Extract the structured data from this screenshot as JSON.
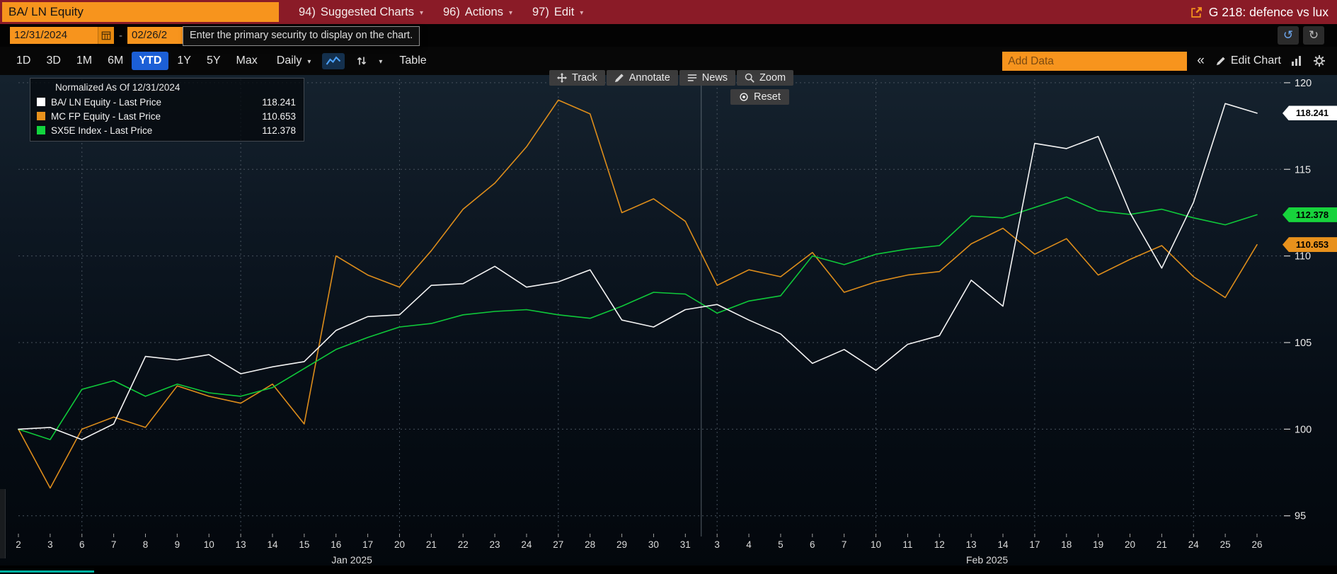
{
  "icons": {
    "caret": "▾",
    "collapse": "«",
    "undo": "↺",
    "redo": "↻",
    "dash": "-"
  },
  "title_bar": {
    "security_input": "BA/ LN Equity",
    "menus": [
      {
        "num": "94)",
        "label": "Suggested Charts"
      },
      {
        "num": "96)",
        "label": "Actions"
      },
      {
        "num": "97)",
        "label": "Edit"
      }
    ],
    "window_title": "G 218: defence vs lux"
  },
  "date_row": {
    "date_from": "12/31/2024",
    "date_to": "02/26/2",
    "tooltip": "Enter the primary security to display on the chart."
  },
  "toolbar_row2": {
    "periods": [
      "1D",
      "3D",
      "1M",
      "6M",
      "YTD",
      "1Y",
      "5Y",
      "Max"
    ],
    "active_period": "YTD",
    "frequency": "Daily",
    "table_label": "Table",
    "add_data_placeholder": "Add Data",
    "edit_chart_label": "Edit Chart",
    "active_period_color": "#1c5fd6",
    "accent_orange": "#f7941d"
  },
  "chart_overlay": {
    "legend_title": "Normalized As Of 12/31/2024",
    "legend_items": [
      {
        "label": "BA/ LN Equity - Last Price",
        "value": "118.241",
        "color": "#ffffff"
      },
      {
        "label": "MC FP Equity - Last Price",
        "value": "110.653",
        "color": "#e8911c"
      },
      {
        "label": "SX5E Index - Last Price",
        "value": "112.378",
        "color": "#12d43e"
      }
    ],
    "tools": [
      "Track",
      "Annotate",
      "News",
      "Zoom"
    ],
    "reset_label": "Reset",
    "badges": [
      {
        "value": "118.241",
        "bg": "#ffffff"
      },
      {
        "value": "112.378",
        "bg": "#17d33c"
      },
      {
        "value": "110.653",
        "bg": "#e8911c"
      }
    ]
  },
  "chart_data": {
    "type": "line",
    "title": "Normalized As Of 12/31/2024",
    "x_labels": [
      "2",
      "3",
      "6",
      "7",
      "8",
      "9",
      "10",
      "13",
      "14",
      "15",
      "16",
      "17",
      "20",
      "21",
      "22",
      "23",
      "24",
      "27",
      "28",
      "29",
      "30",
      "31",
      "3",
      "4",
      "5",
      "6",
      "7",
      "10",
      "11",
      "12",
      "13",
      "14",
      "17",
      "18",
      "19",
      "20",
      "21",
      "24",
      "25",
      "26"
    ],
    "month_labels": [
      {
        "label": "Jan 2025",
        "start_index": 0,
        "end_index": 21
      },
      {
        "label": "Feb 2025",
        "start_index": 22,
        "end_index": 39
      }
    ],
    "yticks": [
      95,
      100,
      105,
      110,
      115,
      120
    ],
    "ylim": [
      94.05,
      120.2
    ],
    "grid": "dotted",
    "legend_position": "top-left",
    "week_start_indices": [
      2,
      7,
      12,
      17,
      22,
      27,
      32,
      37
    ],
    "month_separator_after_index": 21,
    "draw_order": [
      1,
      2,
      0
    ],
    "series": [
      {
        "name": "BA/ LN Equity - Last Price",
        "color": "#f4f4f4",
        "last": 118.241,
        "values": [
          100.0,
          100.1,
          99.4,
          100.3,
          104.2,
          104.0,
          104.3,
          103.2,
          103.6,
          103.9,
          105.7,
          106.5,
          106.6,
          108.3,
          108.4,
          109.4,
          108.2,
          108.5,
          109.2,
          106.3,
          105.9,
          106.9,
          107.2,
          106.3,
          105.5,
          103.8,
          104.6,
          103.4,
          104.9,
          105.4,
          108.6,
          107.1,
          116.5,
          116.2,
          116.9,
          112.5,
          109.3,
          113.1,
          118.8,
          118.241
        ]
      },
      {
        "name": "MC FP Equity - Last Price",
        "color": "#dd8d1b",
        "last": 110.653,
        "values": [
          100.0,
          96.6,
          100.0,
          100.7,
          100.1,
          102.5,
          101.9,
          101.5,
          102.6,
          100.3,
          110.0,
          108.9,
          108.2,
          110.3,
          112.7,
          114.2,
          116.3,
          119.0,
          118.2,
          112.5,
          113.3,
          112.0,
          108.3,
          109.2,
          108.8,
          110.2,
          107.9,
          108.5,
          108.9,
          109.1,
          110.7,
          111.6,
          110.1,
          111.0,
          108.9,
          109.8,
          110.6,
          108.8,
          107.6,
          110.653
        ]
      },
      {
        "name": "SX5E Index - Last Price",
        "color": "#0fc93a",
        "last": 112.378,
        "values": [
          100.0,
          99.4,
          102.3,
          102.8,
          101.9,
          102.6,
          102.1,
          101.9,
          102.4,
          103.5,
          104.6,
          105.3,
          105.9,
          106.1,
          106.6,
          106.8,
          106.9,
          106.6,
          106.4,
          107.1,
          107.9,
          107.8,
          106.7,
          107.4,
          107.7,
          110.0,
          109.5,
          110.1,
          110.4,
          110.6,
          112.3,
          112.2,
          112.8,
          113.4,
          112.6,
          112.4,
          112.7,
          112.2,
          111.8,
          112.378
        ]
      }
    ]
  }
}
